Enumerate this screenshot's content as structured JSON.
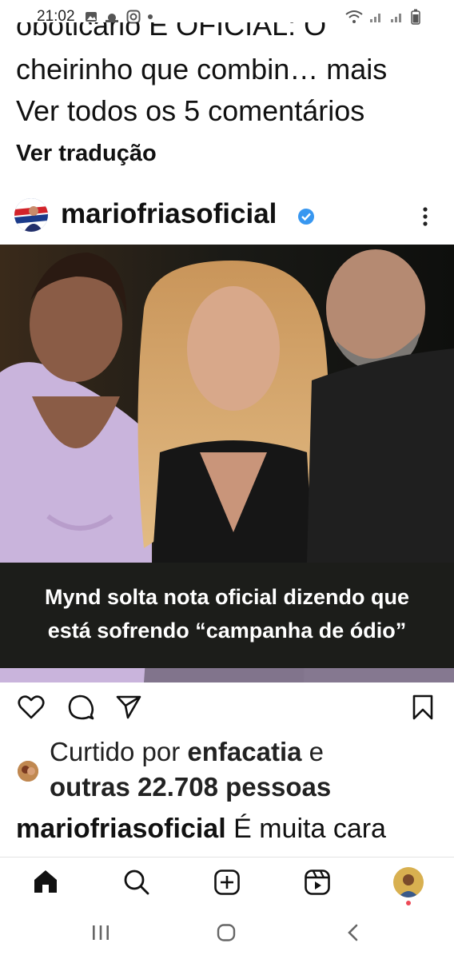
{
  "status_bar": {
    "time": "21:02"
  },
  "previous_post": {
    "caption_cut_line": "oboticario É OFICIAL: O",
    "caption_line": "cheirinho que combin… mais",
    "view_comments": "Ver todos os 5 comentários",
    "see_translation": "Ver tradução"
  },
  "post": {
    "username": "mariofriasoficial",
    "overlay_line1": "Mynd solta nota oficial dizendo que",
    "overlay_line2": "está sofrendo “campanha de ódio”",
    "liked_by_prefix": "Curtido por ",
    "liked_by_user": "enfacatia",
    "liked_by_conj": " e",
    "liked_by_others": "outras 22.708 pessoas",
    "caption_user": "mariofriasoficial",
    "caption_text": " É muita cara"
  },
  "icons": {
    "like": "heart-icon",
    "comment": "comment-icon",
    "share": "send-icon",
    "save": "bookmark-icon",
    "more": "more-vertical-icon",
    "home": "home-icon",
    "search": "search-icon",
    "create": "add-icon",
    "reels": "reels-icon",
    "profile": "profile-avatar"
  },
  "colors": {
    "verified": "#3897f0",
    "notification_dot": "#ed4956",
    "overlay_bg": "#1c1d1a"
  }
}
